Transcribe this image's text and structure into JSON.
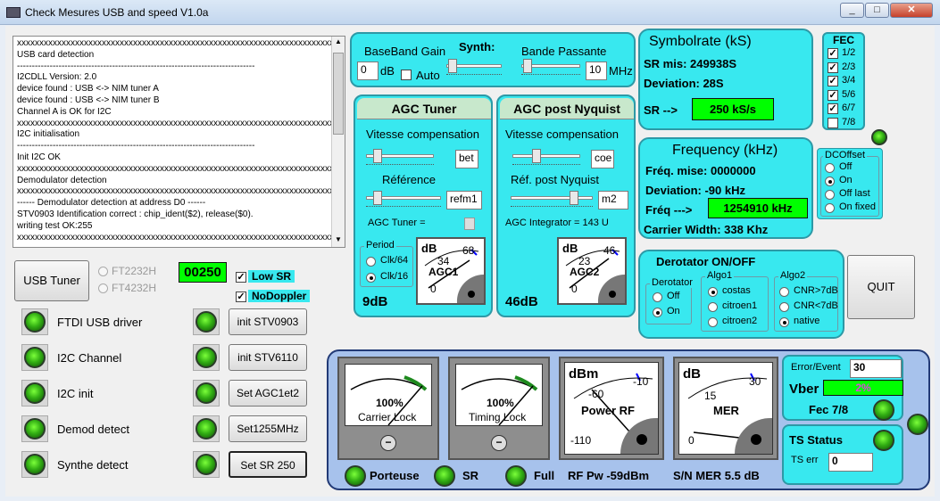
{
  "window": {
    "title": "Check Mesures USB and speed V1.0a"
  },
  "log": {
    "lines": [
      "xxxxxxxxxxxxxxxxxxxxxxxxxxxxxxxxxxxxxxxxxxxxxxxxxxxxxxxxxxxxxxxxxxxxxxxxxxxx",
      "USB card detection",
      "--------------------------------------------------------------------------------",
      "I2CDLL Version: 2.0",
      "device found : USB <-> NIM tuner A",
      "device found : USB <-> NIM tuner B",
      "Channel A is OK for I2C",
      "xxxxxxxxxxxxxxxxxxxxxxxxxxxxxxxxxxxxxxxxxxxxxxxxxxxxxxxxxxxxxxxxxxxxxxxxxxxx",
      "                         I2C initialisation",
      "--------------------------------------------------------------------------------",
      "Init I2C OK",
      "xxxxxxxxxxxxxxxxxxxxxxxxxxxxxxxxxxxxxxxxxxxxxxxxxxxxxxxxxxxxxxxxxxxxxxxxxxxx",
      "                         Demodulator detection",
      "xxxxxxxxxxxxxxxxxxxxxxxxxxxxxxxxxxxxxxxxxxxxxxxxxxxxxxxxxxxxxxxxxxxxxxxxxxxx",
      "------ Demodulator detection at address D0 ------",
      "STV0903 Identification correct : chip_ident($2), release($0).",
      "writing test OK:255",
      "xxxxxxxxxxxxxxxxxxxxxxxxxxxxxxxxxxxxxxxxxxxxxxxxxxxxxxxxxxxxxxxxxxxxxxxxxxxx"
    ]
  },
  "left": {
    "usb_tuner": "USB Tuner",
    "ft2232h": "FT2232H",
    "ft4232h": "FT4232H",
    "counter": "00250",
    "low_sr": "Low SR",
    "nodoppler": "NoDoppler",
    "status": [
      "FTDI USB driver",
      "I2C Channel",
      "I2C init",
      "Demod detect",
      "Synthe detect"
    ],
    "buttons": [
      "init STV0903",
      "init STV6110",
      "Set AGC1et2",
      "Set1255MHz",
      "Set SR 250"
    ]
  },
  "synth": {
    "baseband": "BaseBand Gain",
    "synth": "Synth:",
    "bande": "Bande Passante",
    "gain_val": "0",
    "db": "dB",
    "auto": "Auto",
    "bw_val": "10",
    "mhz": "MHz"
  },
  "agc_tuner": {
    "title": "AGC Tuner",
    "vitesse": "Vitesse compensation",
    "bet": "bet",
    "reference": "Référence",
    "refm1": "refm1",
    "agc_label": "AGC Tuner =",
    "period": "Period",
    "clk64": "Clk/64",
    "clk16": "Clk/16",
    "value": "9dB",
    "gauge": {
      "unit": "dB",
      "a": "34",
      "b": "68",
      "c": "0",
      "name": "AGC1"
    }
  },
  "agc_nyq": {
    "title": "AGC post Nyquist",
    "vitesse": "Vitesse compensation",
    "coe": "coe",
    "ref": "Réf. post Nyquist",
    "m2": "m2",
    "integrator": "AGC Integrator = 143 U",
    "value": "46dB",
    "gauge": {
      "unit": "dB",
      "a": "23",
      "b": "46",
      "c": "0",
      "name": "AGC2"
    }
  },
  "symbolrate": {
    "title": "Symbolrate (kS)",
    "sr_mis": "SR mis:  249938S",
    "deviation": "Deviation: 28S",
    "sr_arrow": "SR -->",
    "sr_value": "250 kS/s"
  },
  "fec": {
    "title": "FEC",
    "items": [
      {
        "label": "1/2",
        "checked": true
      },
      {
        "label": "2/3",
        "checked": true
      },
      {
        "label": "3/4",
        "checked": true
      },
      {
        "label": "5/6",
        "checked": true
      },
      {
        "label": "6/7",
        "checked": true
      },
      {
        "label": "7/8",
        "checked": false
      }
    ]
  },
  "frequency": {
    "title": "Frequency (kHz)",
    "mise": "Fréq. mise:  0000000",
    "deviation": "Deviation:   -90 kHz",
    "freq_arrow": "Fréq --->",
    "freq_value": "1254910 kHz",
    "carrier": "Carrier Width:  338 Khz"
  },
  "dcoffset": {
    "title": "DCOffset",
    "options": [
      "Off",
      "On",
      "Off last",
      "On fixed"
    ],
    "selected": 1
  },
  "derotator": {
    "title": "Derotator  ON/OFF",
    "group": "Derotator",
    "opts": [
      "Off",
      "On"
    ],
    "algo1": "Algo1",
    "algo1_opts": [
      "costas",
      "citroen1",
      "citroen2"
    ],
    "algo2": "Algo2",
    "algo2_opts": [
      "CNR>7dB",
      "CNR<7dB",
      "native"
    ]
  },
  "quit": "QUIT",
  "meters": {
    "carrier": {
      "pct": "100%",
      "label": "Carrier Lock"
    },
    "timing": {
      "pct": "100%",
      "label": "Timing Lock"
    },
    "power": {
      "unit": "dBm",
      "a": "-60",
      "b": "-10",
      "c": "-110",
      "label": "Power RF"
    },
    "mer": {
      "unit": "dB",
      "a": "15",
      "b": "30",
      "c": "0",
      "label": "MER"
    },
    "porteuse": "Porteuse",
    "sr": "SR",
    "full": "Full",
    "rfpw": "RF Pw -59dBm",
    "snmer": "S/N MER 5.5 dB"
  },
  "errors": {
    "title": "Error/Event",
    "value": "30",
    "vber": "Vber",
    "vber_val": "2%",
    "fec": "Fec 7/8"
  },
  "ts": {
    "title": "TS Status",
    "err": "TS err",
    "err_val": "0"
  }
}
